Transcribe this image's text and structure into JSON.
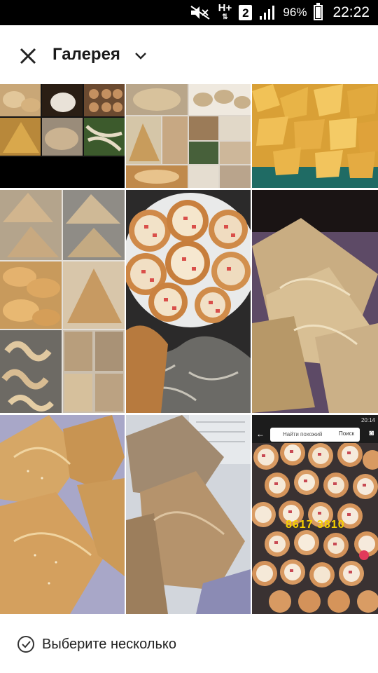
{
  "status_bar": {
    "network": "H+",
    "sim": "2",
    "battery_percent": "96%",
    "time": "22:22"
  },
  "app_bar": {
    "title": "Галерея",
    "close_icon": "close-icon",
    "dropdown_icon": "chevron-down-icon"
  },
  "gallery": {
    "photos": [
      {
        "name": "photo-pastry-collage-1"
      },
      {
        "name": "photo-pastry-collage-2"
      },
      {
        "name": "photo-fried-triangles"
      },
      {
        "name": "photo-pastry-collage-3"
      },
      {
        "name": "photo-mini-pizzas"
      },
      {
        "name": "photo-samsa-1"
      },
      {
        "name": "photo-samsa-2"
      },
      {
        "name": "photo-samsa-3"
      },
      {
        "name": "photo-pizza-screenshot"
      }
    ],
    "screenshot_overlay": {
      "search_placeholder": "Найти похожий",
      "search_button": "Поиск",
      "phone_time": "20:14",
      "watermark": "8617 3810"
    }
  },
  "footer": {
    "select_multiple_label": "Выберите несколько",
    "select_icon": "check-circle-icon"
  },
  "colors": {
    "status_bar": "#000000",
    "background": "#ffffff",
    "text": "#1a1a1a"
  }
}
